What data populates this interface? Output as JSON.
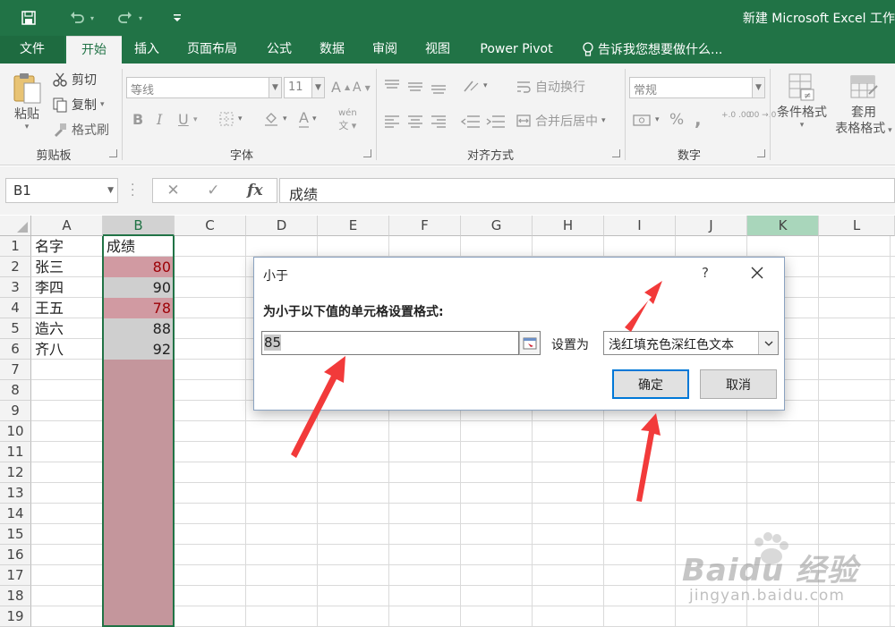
{
  "app": {
    "title": "新建 Microsoft Excel 工作",
    "accent": "#217346"
  },
  "quick_access": {
    "icons": [
      "save-icon",
      "undo-icon",
      "redo-icon",
      "customize-icon"
    ]
  },
  "tabs": [
    {
      "label": "文件"
    },
    {
      "label": "开始",
      "active": true
    },
    {
      "label": "插入"
    },
    {
      "label": "页面布局"
    },
    {
      "label": "公式"
    },
    {
      "label": "数据"
    },
    {
      "label": "审阅"
    },
    {
      "label": "视图"
    },
    {
      "label": "Power Pivot"
    }
  ],
  "tell_me": "告诉我您想要做什么...",
  "ribbon": {
    "clipboard": {
      "paste": "粘贴",
      "cut": "剪切",
      "copy": "复制",
      "format_painter": "格式刷",
      "group": "剪贴板"
    },
    "font": {
      "font_name": "等线",
      "font_size": "11",
      "bold": "B",
      "italic": "I",
      "underline": "U",
      "grow": "A",
      "shrink": "A",
      "font_color": "A",
      "phonetic": "wén",
      "group": "字体"
    },
    "alignment": {
      "wrap_text": "自动换行",
      "merge_center": "合并后居中",
      "group": "对齐方式"
    },
    "number": {
      "format": "常规",
      "percent": "%",
      "comma": ",",
      "inc_decimal": "+.0 .00",
      "dec_decimal": ".00 →.0",
      "group": "数字"
    },
    "styles": {
      "conditional": "条件格式",
      "table_format_1": "套用",
      "table_format_2": "表格格式"
    }
  },
  "formula_bar": {
    "name_box": "B1",
    "formula": "成绩",
    "cancel": "✕",
    "enter": "✓",
    "fx": "fx"
  },
  "columns": [
    "A",
    "B",
    "C",
    "D",
    "E",
    "F",
    "G",
    "H",
    "I",
    "J",
    "K",
    "L"
  ],
  "rows": [
    "1",
    "2",
    "3",
    "4",
    "5",
    "6",
    "7",
    "8",
    "9",
    "10",
    "11",
    "12",
    "13",
    "14",
    "15",
    "16",
    "17",
    "18",
    "19"
  ],
  "table": {
    "headers": [
      "名字",
      "成绩"
    ],
    "rows": [
      {
        "name": "张三",
        "score": "80",
        "low": true
      },
      {
        "name": "李四",
        "score": "90",
        "low": false
      },
      {
        "name": "王五",
        "score": "78",
        "low": true
      },
      {
        "name": "造六",
        "score": "88",
        "low": false
      },
      {
        "name": "齐八",
        "score": "92",
        "low": false
      }
    ],
    "low_fill": "#d19aa2",
    "low_text": "#9c0006",
    "preview_fill": "#c4969c",
    "normal_fill": "#cfcfcf"
  },
  "dialog": {
    "title": "小于",
    "help": "?",
    "prompt": "为小于以下值的单元格设置格式:",
    "value": "85",
    "set_as_label": "设置为",
    "format_option": "浅红填充色深红色文本",
    "ok": "确定",
    "cancel": "取消"
  },
  "watermark": {
    "line1": "Baidu 经验",
    "line2": "jingyan.baidu.com"
  }
}
